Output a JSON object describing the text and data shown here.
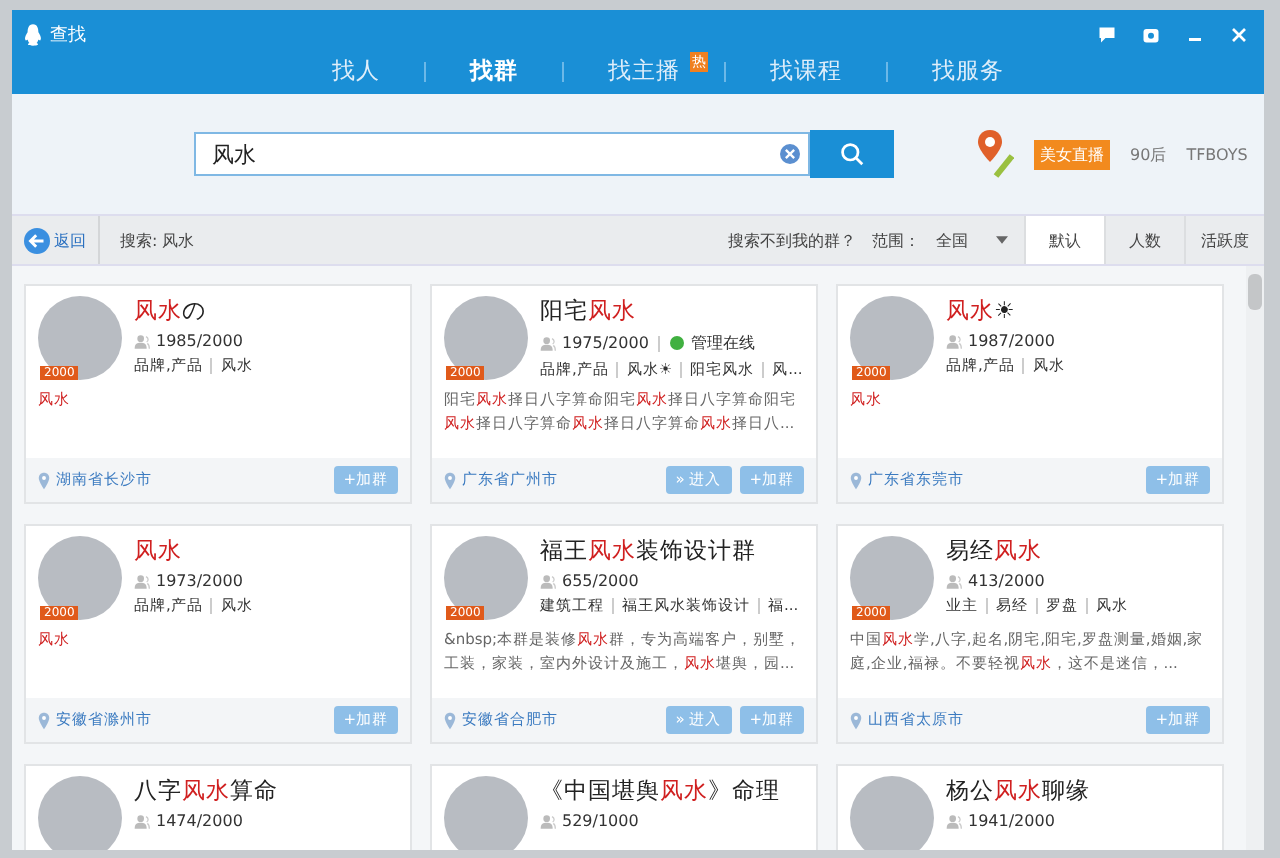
{
  "window": {
    "title": "查找"
  },
  "tabs": [
    {
      "label": "找人",
      "selected": false
    },
    {
      "label": "找群",
      "selected": true
    },
    {
      "label": "找主播",
      "selected": false,
      "badge": "热"
    },
    {
      "label": "找课程",
      "selected": false
    },
    {
      "label": "找服务",
      "selected": false
    }
  ],
  "search": {
    "value": "风水",
    "hot_tags": [
      {
        "label": "美女直播",
        "kind": "tag"
      },
      {
        "label": "90后",
        "kind": "plain"
      },
      {
        "label": "TFBOYS",
        "kind": "plain"
      }
    ]
  },
  "toolbar": {
    "back": "返回",
    "query": "搜索: 风水",
    "help": "搜索不到我的群？",
    "scope_label": "范围：",
    "scope": "全国",
    "sorts": [
      {
        "label": "默认",
        "selected": true
      },
      {
        "label": "人数",
        "selected": false
      },
      {
        "label": "活跃度",
        "selected": false
      }
    ]
  },
  "groups": [
    {
      "title": [
        {
          "text": "风水",
          "match": true
        },
        {
          "text": "の",
          "match": false
        }
      ],
      "badge": "2000",
      "members": "1985/2000",
      "tags": [
        "品牌,产品",
        "风水"
      ],
      "desc": [
        {
          "text": "风水",
          "match": true
        }
      ],
      "location": "湖南省长沙市",
      "join": "+加群"
    },
    {
      "title": [
        {
          "text": "阳宅",
          "match": false
        },
        {
          "text": "风水",
          "match": true
        }
      ],
      "badge": "2000",
      "members": "1975/2000",
      "online": "管理在线",
      "tags": [
        "品牌,产品",
        "风水☀",
        "阳宅风水",
        "风..."
      ],
      "desc": [
        {
          "text": "阳宅",
          "match": false
        },
        {
          "text": "风水",
          "match": true
        },
        {
          "text": "择日八字算命阳宅",
          "match": false
        },
        {
          "text": "风水",
          "match": true
        },
        {
          "text": "择日八字算命阳宅",
          "match": false
        },
        {
          "text": "风水",
          "match": true
        },
        {
          "text": "择日八字算命",
          "match": false
        },
        {
          "text": "风水",
          "match": true
        },
        {
          "text": "择日八字算命",
          "match": false
        },
        {
          "text": "风水",
          "match": true
        },
        {
          "text": "择日八...",
          "match": false
        }
      ],
      "location": "广东省广州市",
      "enter": "» 进入",
      "join": "+加群"
    },
    {
      "title": [
        {
          "text": "风水",
          "match": true
        },
        {
          "text": "☀",
          "match": false
        }
      ],
      "badge": "2000",
      "members": "1987/2000",
      "tags": [
        "品牌,产品",
        "风水"
      ],
      "desc": [
        {
          "text": "风水",
          "match": true
        }
      ],
      "location": "广东省东莞市",
      "join": "+加群"
    },
    {
      "title": [
        {
          "text": "风水",
          "match": true
        }
      ],
      "badge": "2000",
      "members": "1973/2000",
      "tags": [
        "品牌,产品",
        "风水"
      ],
      "desc": [
        {
          "text": "风水",
          "match": true
        }
      ],
      "location": "安徽省滁州市",
      "join": "+加群"
    },
    {
      "title": [
        {
          "text": "福王",
          "match": false
        },
        {
          "text": "风水",
          "match": true
        },
        {
          "text": "装饰设计群",
          "match": false
        }
      ],
      "badge": "2000",
      "members": "655/2000",
      "tags": [
        "建筑工程",
        "福王风水装饰设计",
        "福..."
      ],
      "desc": [
        {
          "text": "&nbsp;本群是装修",
          "match": false
        },
        {
          "text": "风水",
          "match": true
        },
        {
          "text": "群，专为高端客户，别墅，工装，家装，室内外设计及施工，",
          "match": false
        },
        {
          "text": "风水",
          "match": true
        },
        {
          "text": "堪舆，园...",
          "match": false
        }
      ],
      "location": "安徽省合肥市",
      "enter": "» 进入",
      "join": "+加群"
    },
    {
      "title": [
        {
          "text": "易经",
          "match": false
        },
        {
          "text": "风水",
          "match": true
        }
      ],
      "badge": "2000",
      "members": "413/2000",
      "tags": [
        "业主",
        "易经",
        "罗盘",
        "风水"
      ],
      "desc": [
        {
          "text": "中国",
          "match": false
        },
        {
          "text": "风水",
          "match": true
        },
        {
          "text": "学,八字,起名,阴宅,阳宅,罗盘测量,婚姻,家庭,企业,福禄。不要轻视",
          "match": false
        },
        {
          "text": "风水",
          "match": true
        },
        {
          "text": "，这不是迷信，...",
          "match": false
        }
      ],
      "location": "山西省太原市",
      "join": "+加群"
    },
    {
      "title": [
        {
          "text": "八字",
          "match": false
        },
        {
          "text": "风水",
          "match": true
        },
        {
          "text": "算命",
          "match": false
        }
      ],
      "members": "1474/2000"
    },
    {
      "title": [
        {
          "text": "《中国堪舆",
          "match": false
        },
        {
          "text": "风水",
          "match": true
        },
        {
          "text": "》命理",
          "match": false
        }
      ],
      "members": "529/1000"
    },
    {
      "title": [
        {
          "text": "杨公",
          "match": false
        },
        {
          "text": "风水",
          "match": true
        },
        {
          "text": "聊缘",
          "match": false
        }
      ],
      "members": "1941/2000"
    }
  ]
}
